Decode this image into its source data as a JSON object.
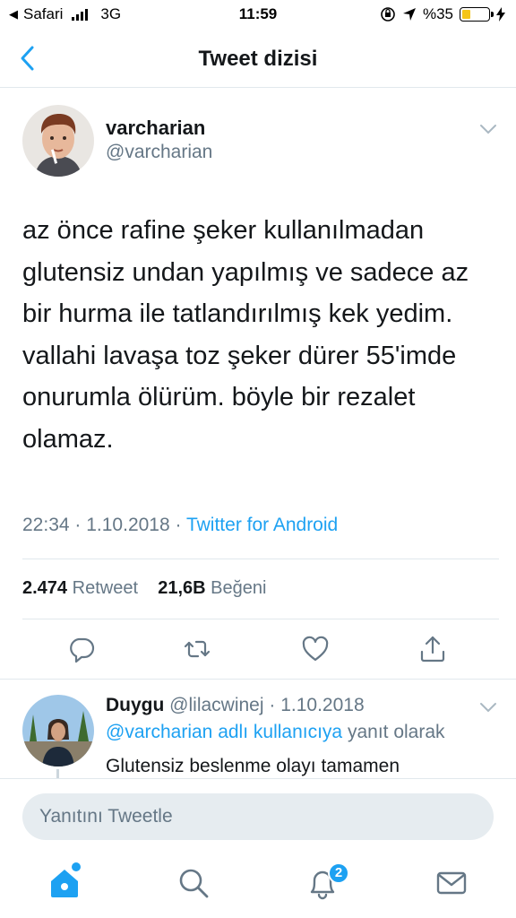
{
  "status_bar": {
    "carrier": "Safari",
    "network": "3G",
    "time": "11:59",
    "battery": "%35",
    "battery_level": 0.35
  },
  "nav": {
    "title": "Tweet dizisi"
  },
  "tweet": {
    "name": "varcharian",
    "handle": "@varcharian",
    "text": "az önce rafine şeker kullanılmadan glutensiz undan yapılmış ve sadece az bir hurma ile tatlandırılmış kek yedim. vallahi lavaşa toz şeker dürer 55'imde onurumla ölürüm. böyle bir rezalet olamaz.",
    "time": "22:34",
    "date": "1.10.2018",
    "source": "Twitter for Android",
    "retweets": "2.474",
    "retweets_label": "Retweet",
    "likes": "21,6B",
    "likes_label": "Beğeni"
  },
  "reply": {
    "name": "Duygu",
    "handle": "@lilacwinej",
    "date": "1.10.2018",
    "reply_to_mention": "@varcharian adlı kullanıcıya",
    "reply_to_suffix": "yanıt olarak",
    "text": "Glutensiz beslenme olayı tamamen"
  },
  "composer": {
    "placeholder": "Yanıtını Tweetle"
  },
  "tabbar": {
    "notifications_badge": "2"
  },
  "colors": {
    "accent": "#1da1f2",
    "secondary_text": "#657786",
    "divider": "#e1e8ed"
  }
}
